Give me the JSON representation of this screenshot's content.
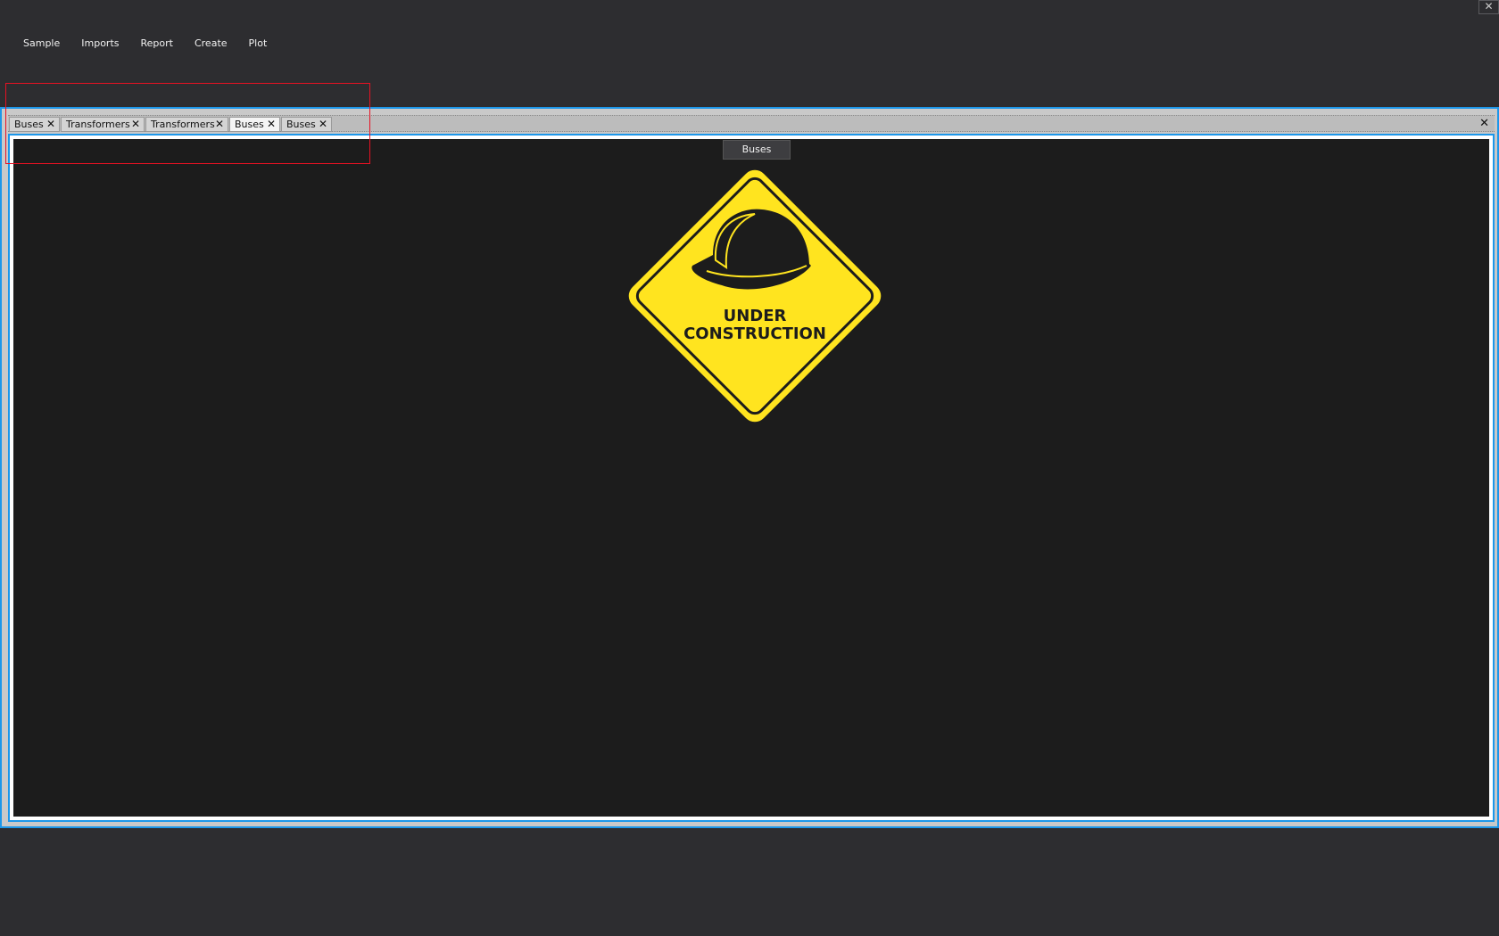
{
  "window": {
    "close_glyph": "✕"
  },
  "menubar": {
    "items": [
      {
        "label": "Sample"
      },
      {
        "label": "Imports"
      },
      {
        "label": "Report"
      },
      {
        "label": "Create"
      },
      {
        "label": "Plot"
      }
    ]
  },
  "tabs": [
    {
      "label": "Buses",
      "active": false
    },
    {
      "label": "Transformers",
      "active": false
    },
    {
      "label": "Transformers",
      "active": false
    },
    {
      "label": "Buses",
      "active": true
    },
    {
      "label": "Buses",
      "active": false
    }
  ],
  "tab_close_glyph": "✕",
  "strip_close_glyph": "✕",
  "content": {
    "view_label": "Buses",
    "sign": {
      "line1": "UNDER",
      "line2": "CONSTRUCTION",
      "icon": "hard-hat-icon"
    }
  },
  "colors": {
    "accent": "#1c97ea",
    "sign_yellow": "#ffe41f",
    "highlight": "#e81123"
  }
}
